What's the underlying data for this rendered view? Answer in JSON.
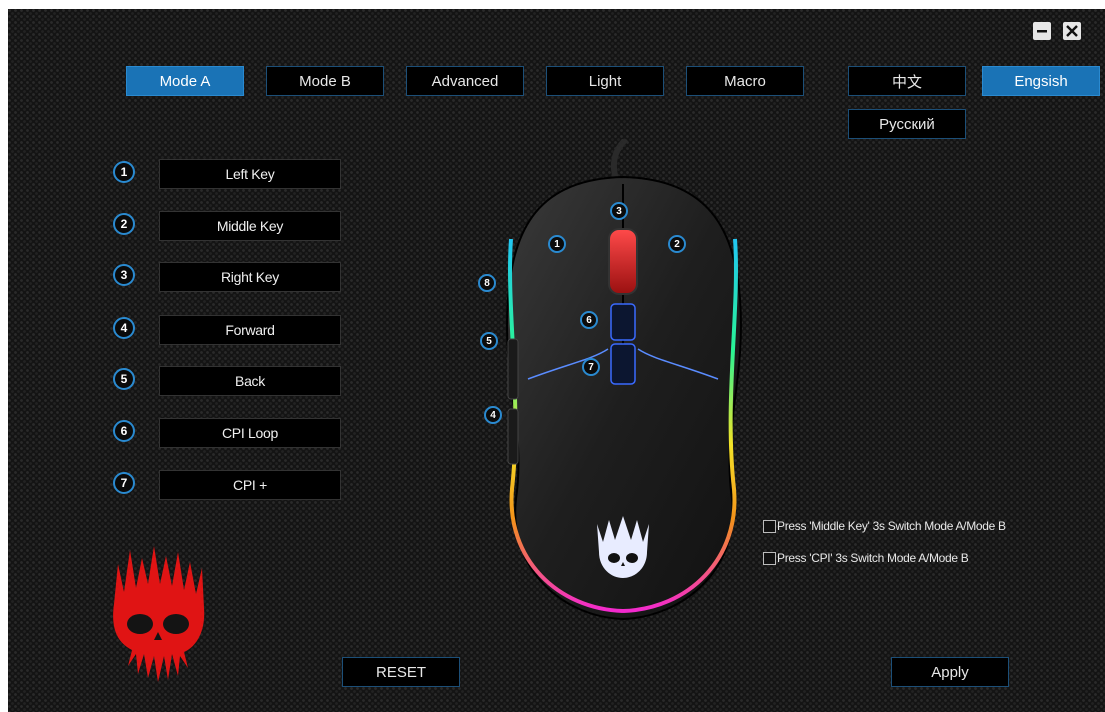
{
  "window": {
    "minimize_icon": "minimize-icon",
    "close_icon": "close-icon"
  },
  "tabs": {
    "mode_a": "Mode A",
    "mode_b": "Mode B",
    "advanced": "Advanced",
    "light": "Light",
    "macro": "Macro"
  },
  "languages": {
    "chinese": "中文",
    "english": "Engsish",
    "russian": "Русский"
  },
  "keys": [
    {
      "num": "1",
      "label": "Left Key"
    },
    {
      "num": "2",
      "label": "Middle Key"
    },
    {
      "num": "3",
      "label": "Right Key"
    },
    {
      "num": "4",
      "label": "Forward"
    },
    {
      "num": "5",
      "label": "Back"
    },
    {
      "num": "6",
      "label": "CPI Loop"
    },
    {
      "num": "7",
      "label": "CPI +"
    }
  ],
  "mouse_markers": [
    "1",
    "2",
    "3",
    "4",
    "5",
    "6",
    "7",
    "8"
  ],
  "options": {
    "middle_switch": "Press 'Middle Key' 3s Switch Mode A/Mode B",
    "cpi_switch": "Press 'CPI' 3s Switch Mode A/Mode B"
  },
  "actions": {
    "reset": "RESET",
    "apply": "Apply"
  },
  "colors": {
    "accent": "#1a73b6",
    "logo_red": "#e01414",
    "background": "#141414"
  }
}
